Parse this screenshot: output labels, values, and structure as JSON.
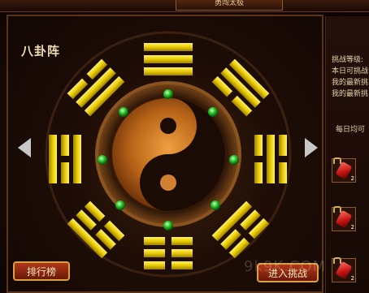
{
  "window": {
    "title": "勇闯太极"
  },
  "panel": {
    "title": "八卦阵"
  },
  "buttons": {
    "rank_label": "排行榜",
    "enter_label": "进入挑战"
  },
  "side": {
    "line1": "挑战等级:",
    "line2": "本日可挑战",
    "line3": "我的最新挑",
    "line4": "我的最新挑",
    "daily": "每日均可",
    "items": [
      {
        "icon": "red-gem-icon",
        "count": "2"
      },
      {
        "icon": "red-gem-icon",
        "count": "2"
      },
      {
        "icon": "red-gem-icon",
        "count": "2"
      }
    ]
  },
  "colors": {
    "gold": "#e8d000",
    "bronze": "#b06a20",
    "green_orb": "#40e040",
    "button_red": "#b03818"
  },
  "watermark": "9k9K.COM"
}
